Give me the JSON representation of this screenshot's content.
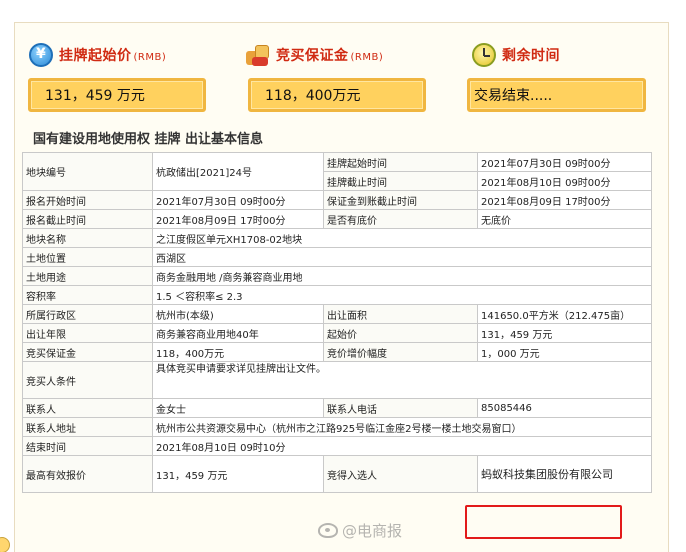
{
  "header": {
    "start_price": {
      "label": "挂牌起始价",
      "unit": "(RMB)",
      "value": "131，459 万元",
      "icon": "coin-icon"
    },
    "deposit": {
      "label": "竞买保证金",
      "unit": "(RMB)",
      "value": "118，400万元",
      "icon": "money-bags-icon"
    },
    "remaining": {
      "label": "剩余时间",
      "value": "交易结束.....",
      "icon": "clock-icon"
    }
  },
  "section_title": "国有建设用地使用权 挂牌 出让基本信息",
  "rows": {
    "r1": {
      "l1": "地块编号",
      "v1": "杭政储出[2021]24号",
      "l2": "挂牌起始时间",
      "v2": "2021年07月30日 09时00分"
    },
    "r1b": {
      "l2": "挂牌截止时间",
      "v2": "2021年08月10日 09时00分"
    },
    "r2": {
      "l1": "报名开始时间",
      "v1": "2021年07月30日 09时00分",
      "l2": "保证金到账截止时间",
      "v2": "2021年08月09日 17时00分"
    },
    "r3": {
      "l1": "报名截止时间",
      "v1": "2021年08月09日 17时00分",
      "l2": "是否有底价",
      "v2": "无底价"
    },
    "r4": {
      "l1": "地块名称",
      "v1": "之江度假区单元XH1708-02地块"
    },
    "r5": {
      "l1": "土地位置",
      "v1": "西湖区"
    },
    "r6": {
      "l1": "土地用途",
      "v1": "商务金融用地 /商务兼容商业用地"
    },
    "r7": {
      "l1": "容积率",
      "v1": "1.5 ＜容积率≤ 2.3"
    },
    "r8": {
      "l1": "所属行政区",
      "v1": "杭州市(本级)",
      "l2": "出让面积",
      "v2": "141650.0平方米（212.475亩）"
    },
    "r9": {
      "l1": "出让年限",
      "v1": "商务兼容商业用地40年",
      "l2": "起始价",
      "v2": "131，459 万元"
    },
    "r10": {
      "l1": "竞买保证金",
      "v1": "118，400万元",
      "l2": "竞价增价幅度",
      "v2": "1，000 万元"
    },
    "r11": {
      "l1": "竞买人条件",
      "v1": "具体竞买申请要求详见挂牌出让文件。"
    },
    "r12": {
      "l1": "联系人",
      "v1": "金女士",
      "l2": "联系人电话",
      "v2": "85085446"
    },
    "r13": {
      "l1": "联系人地址",
      "v1": "杭州市公共资源交易中心（杭州市之江路925号临江金座2号楼一楼土地交易窗口）"
    },
    "r14": {
      "l1": "结束时间",
      "v1": "2021年08月10日 09时10分"
    },
    "r15": {
      "l1": "最高有效报价",
      "v1": "131，459 万元",
      "l2": "竞得入选人",
      "v2": "蚂蚁科技集团股份有限公司"
    }
  },
  "watermark": "@电商报"
}
